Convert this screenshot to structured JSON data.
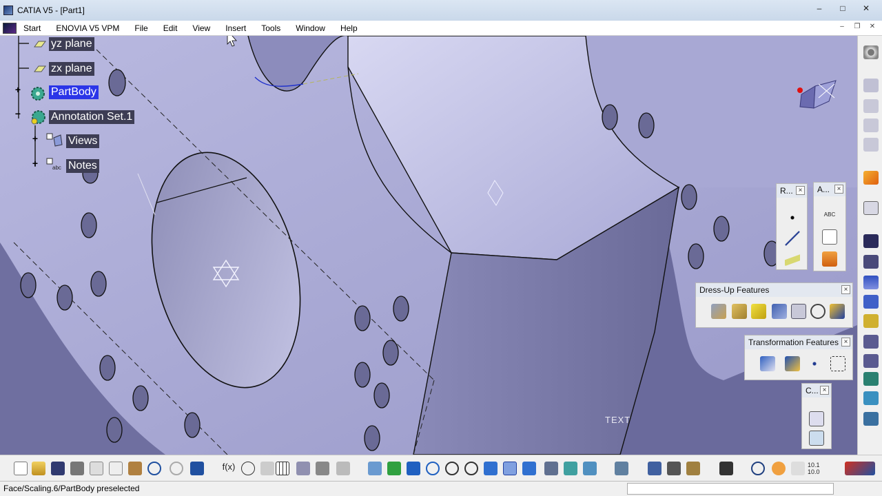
{
  "window": {
    "title": "CATIA V5 - [Part1]",
    "controls": [
      "–",
      "□",
      "✕"
    ]
  },
  "menu": {
    "items": [
      "Start",
      "ENOVIA V5 VPM",
      "File",
      "Edit",
      "View",
      "Insert",
      "Tools",
      "Window",
      "Help"
    ],
    "mdi_controls": [
      "–",
      "❐",
      "✕"
    ]
  },
  "tree": {
    "items": [
      {
        "label": "yz plane",
        "icon": "plane-icon"
      },
      {
        "label": "zx plane",
        "icon": "plane-icon"
      },
      {
        "label": "PartBody",
        "icon": "gear-icon",
        "selected": true
      },
      {
        "label": "Annotation Set.1",
        "icon": "annotation-set-icon"
      },
      {
        "label": "Views",
        "icon": "views-icon"
      },
      {
        "label": "Notes",
        "icon": "notes-icon"
      }
    ]
  },
  "viewport": {
    "text_annotation": "TEXT"
  },
  "panels": {
    "r_toolbar": {
      "title": "R..."
    },
    "a_toolbar": {
      "title": "A...",
      "abc": "ABC"
    },
    "dressup": {
      "title": "Dress-Up Features"
    },
    "transform": {
      "title": "Transformation Features"
    },
    "c_toolbar": {
      "title": "C..."
    }
  },
  "status": {
    "text": "Face/Scaling.6/PartBody preselected"
  },
  "colors": {
    "selection": "#2b35e8",
    "viewport": "#7272a4",
    "cursor_highlight": "#e8e000"
  }
}
